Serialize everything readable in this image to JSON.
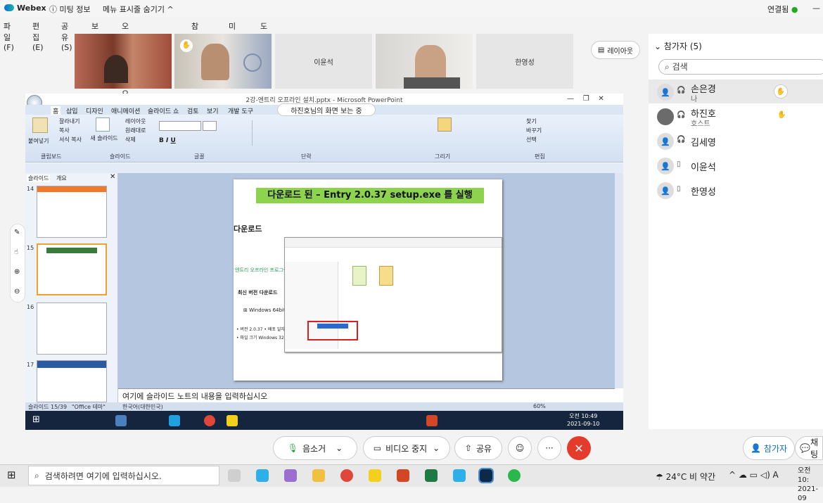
{
  "titlebar": {
    "app": "Webex",
    "meeting_info": "미팅 정보",
    "hide_menu": "메뉴 표시줄 숨기기 ^",
    "connection": "연결됨",
    "minimize": "—"
  },
  "menu": [
    "파일(F)",
    "편집(E)",
    "공유(S)",
    "보기(V)",
    "오디오 및 비디오(A)",
    "참가자(P)",
    "미팅(M)",
    "도움말(H)"
  ],
  "tiles": {
    "t3_name": "이윤석",
    "t5_name": "한영성"
  },
  "layout_button": "레이아웃",
  "panel": {
    "title": "참가자 (5)",
    "search_placeholder": "검색",
    "participants": [
      {
        "name": "손은경",
        "role": "나"
      },
      {
        "name": "하진호",
        "role": "호스트"
      },
      {
        "name": "김세영",
        "role": ""
      },
      {
        "name": "이윤석",
        "role": ""
      },
      {
        "name": "한영성",
        "role": ""
      }
    ]
  },
  "share": {
    "ppt_title": "2강-엔트리 오프라인 설치.pptx - Microsoft PowerPoint",
    "viewing_label": "하진호님의 화면 보는 중",
    "tabs": [
      "홈",
      "삽입",
      "디자인",
      "애니메이션",
      "슬라이드 쇼",
      "검토",
      "보기",
      "개발 도구"
    ],
    "ribbon": {
      "paste": "붙여넣기",
      "cut": "잘라내기",
      "copy": "복사",
      "format_copy": "서식 복사",
      "new_slide": "새 슬라이드",
      "layout": "레이아웃",
      "reset": "원래대로",
      "delete": "삭제",
      "find": "찾기",
      "replace": "바꾸기",
      "select": "선택",
      "groups": [
        "클립보드",
        "슬라이드",
        "글꼴",
        "단락",
        "그리기",
        "편집"
      ]
    },
    "thumb_tabs": [
      "슬라이드",
      "개요"
    ],
    "thumb_numbers": [
      "14",
      "15",
      "16",
      "17"
    ],
    "slide_heading": "다운로드 된 – Entry 2.0.37 setup.exe 를 실행",
    "slide_sub": "다운로드",
    "slide_text1": "엔트리 오프라인 프로그램",
    "slide_text2": "최신 버전 다운로드",
    "slide_text3": "Windows 64bit",
    "slide_text4": "• 버전 2.0.37  • 배포 일자 2",
    "slide_text5": "• 파일 크기 Windows 32bit 3",
    "notes": "여기에 슬라이드 노트의 내용을 입력하십시오",
    "status_slide": "슬라이드 15/39",
    "status_theme": "\"Office 테마\"",
    "status_lang": "한국어(대한민국)",
    "status_zoom": "60%",
    "inner_clock_time": "오전 10:49",
    "inner_clock_date": "2021-09-10"
  },
  "controls": {
    "mute": "음소거",
    "video": "비디오 중지",
    "share": "공유",
    "participants": "참가자",
    "chat": "채팅"
  },
  "taskbar": {
    "search": "검색하려면 여기에 입력하십시오.",
    "weather": "24°C  비 약간",
    "clock_time": "오전 10:",
    "clock_date": "2021-09"
  }
}
